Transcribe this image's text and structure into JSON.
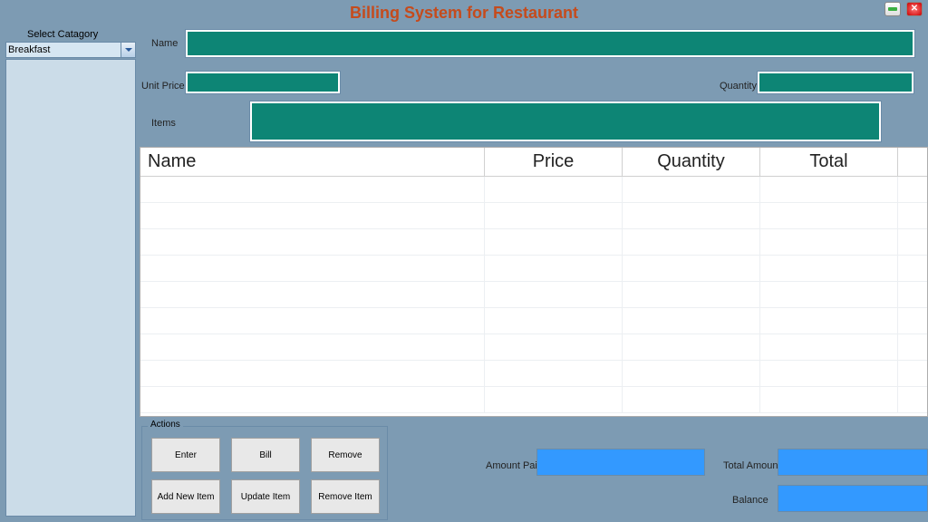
{
  "title": "Billing System for Restaurant",
  "category": {
    "label": "Select Catagory",
    "selected": "Breakfast"
  },
  "form": {
    "name_label": "Name",
    "name_value": "",
    "unit_price_label": "Unit Price",
    "unit_price_value": "",
    "quantity_label": "Quantity",
    "quantity_value": "",
    "items_label": "Items",
    "items_value": ""
  },
  "table": {
    "headers": {
      "name": "Name",
      "price": "Price",
      "quantity": "Quantity",
      "total": "Total"
    }
  },
  "actions": {
    "legend": "Actions",
    "enter": "Enter",
    "bill": "Bill",
    "remove": "Remove",
    "add_new_item": "Add New Item",
    "update_item": "Update Item",
    "remove_item": "Remove Item"
  },
  "totals": {
    "amount_paid_label": "Amount Paid",
    "amount_paid_value": "",
    "total_amount_label": "Total Amount",
    "total_amount_value": "",
    "balance_label": "Balance",
    "balance_value": ""
  }
}
